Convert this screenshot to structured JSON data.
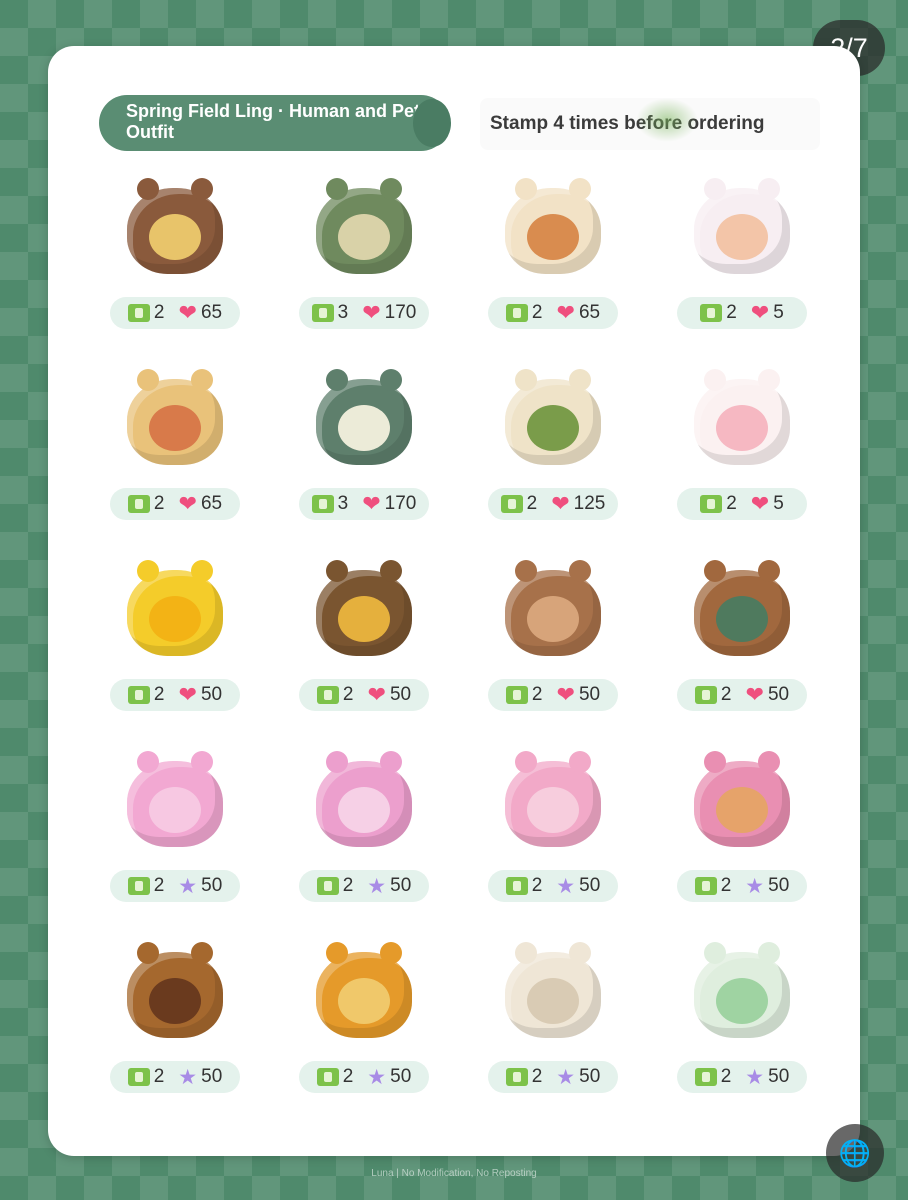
{
  "page_counter": "2/7",
  "title": "Spring Field Ling · Human and Pet Outfit",
  "stamp_note": "Stamp 4 times before ordering",
  "footer": "Luna | No Modification, No Reposting",
  "icons": {
    "ticket": "ticket-icon",
    "heart": "heart-icon",
    "star": "star-icon",
    "translate": "translate-icon"
  },
  "colors": {
    "accent": "#5a8d73",
    "background": "#4f8a6c",
    "heart": "#ef4f7e",
    "star": "#a88be6",
    "ticket": "#7dc24a",
    "pill": "#e4f2ec"
  },
  "items": [
    {
      "tickets": "2",
      "currency": "heart",
      "amount": "65",
      "icon": "bear-hat-icon",
      "color": "#8a5a3c",
      "accent": "#e8c46a"
    },
    {
      "tickets": "3",
      "currency": "heart",
      "amount": "170",
      "icon": "vest-outfit-icon",
      "color": "#6f8a5e",
      "accent": "#d9d2a8"
    },
    {
      "tickets": "2",
      "currency": "heart",
      "amount": "65",
      "icon": "bear-shoes-icon",
      "color": "#f2e2c6",
      "accent": "#d98c4f"
    },
    {
      "tickets": "2",
      "currency": "heart",
      "amount": "5",
      "icon": "face-makeup-icon",
      "color": "#f7eef2",
      "accent": "#f3c5a8"
    },
    {
      "tickets": "2",
      "currency": "heart",
      "amount": "65",
      "icon": "bun-hairstyle-icon",
      "color": "#e9c27a",
      "accent": "#d87a4a"
    },
    {
      "tickets": "3",
      "currency": "heart",
      "amount": "170",
      "icon": "shirt-outfit-icon",
      "color": "#5e7f6c",
      "accent": "#ecebd8"
    },
    {
      "tickets": "2",
      "currency": "heart",
      "amount": "125",
      "icon": "backpack-icon",
      "color": "#efe3c8",
      "accent": "#7a9c4a"
    },
    {
      "tickets": "2",
      "currency": "heart",
      "amount": "5",
      "icon": "face-blush-icon",
      "color": "#fbf1f1",
      "accent": "#f6b8c2"
    },
    {
      "tickets": "2",
      "currency": "heart",
      "amount": "50",
      "icon": "bee-hood-icon",
      "color": "#f4cc2a",
      "accent": "#f3b315"
    },
    {
      "tickets": "2",
      "currency": "heart",
      "amount": "50",
      "icon": "bee-pet-hat-icon",
      "color": "#7a5530",
      "accent": "#e5b03d"
    },
    {
      "tickets": "2",
      "currency": "heart",
      "amount": "50",
      "icon": "bear-hood-icon",
      "color": "#a7714a",
      "accent": "#d7a47a"
    },
    {
      "tickets": "2",
      "currency": "heart",
      "amount": "50",
      "icon": "bear-pet-suit-icon",
      "color": "#a1683e",
      "accent": "#4f7a5e"
    },
    {
      "tickets": "2",
      "currency": "star",
      "amount": "50",
      "icon": "pink-bee-hood-icon",
      "color": "#f2a8d2",
      "accent": "#f7c8e2"
    },
    {
      "tickets": "2",
      "currency": "star",
      "amount": "50",
      "icon": "pink-bee-pet-hat-icon",
      "color": "#ec9fcd",
      "accent": "#f6d0e6"
    },
    {
      "tickets": "2",
      "currency": "star",
      "amount": "50",
      "icon": "pink-bear-hood-icon",
      "color": "#f2a9c8",
      "accent": "#f7cddd"
    },
    {
      "tickets": "2",
      "currency": "star",
      "amount": "50",
      "icon": "pink-bear-pet-suit-icon",
      "color": "#e98fb2",
      "accent": "#e6a36a"
    },
    {
      "tickets": "2",
      "currency": "star",
      "amount": "50",
      "icon": "brown-bee-hood-icon",
      "color": "#a5682e",
      "accent": "#6a3a1e"
    },
    {
      "tickets": "2",
      "currency": "star",
      "amount": "50",
      "icon": "orange-bee-pet-hat-icon",
      "color": "#e59a2a",
      "accent": "#f0c86a"
    },
    {
      "tickets": "2",
      "currency": "star",
      "amount": "50",
      "icon": "white-bear-hood-icon",
      "color": "#efe6d6",
      "accent": "#d9cbb4"
    },
    {
      "tickets": "2",
      "currency": "star",
      "amount": "50",
      "icon": "mint-bear-pet-suit-icon",
      "color": "#dfeede",
      "accent": "#9fd3a2"
    }
  ]
}
